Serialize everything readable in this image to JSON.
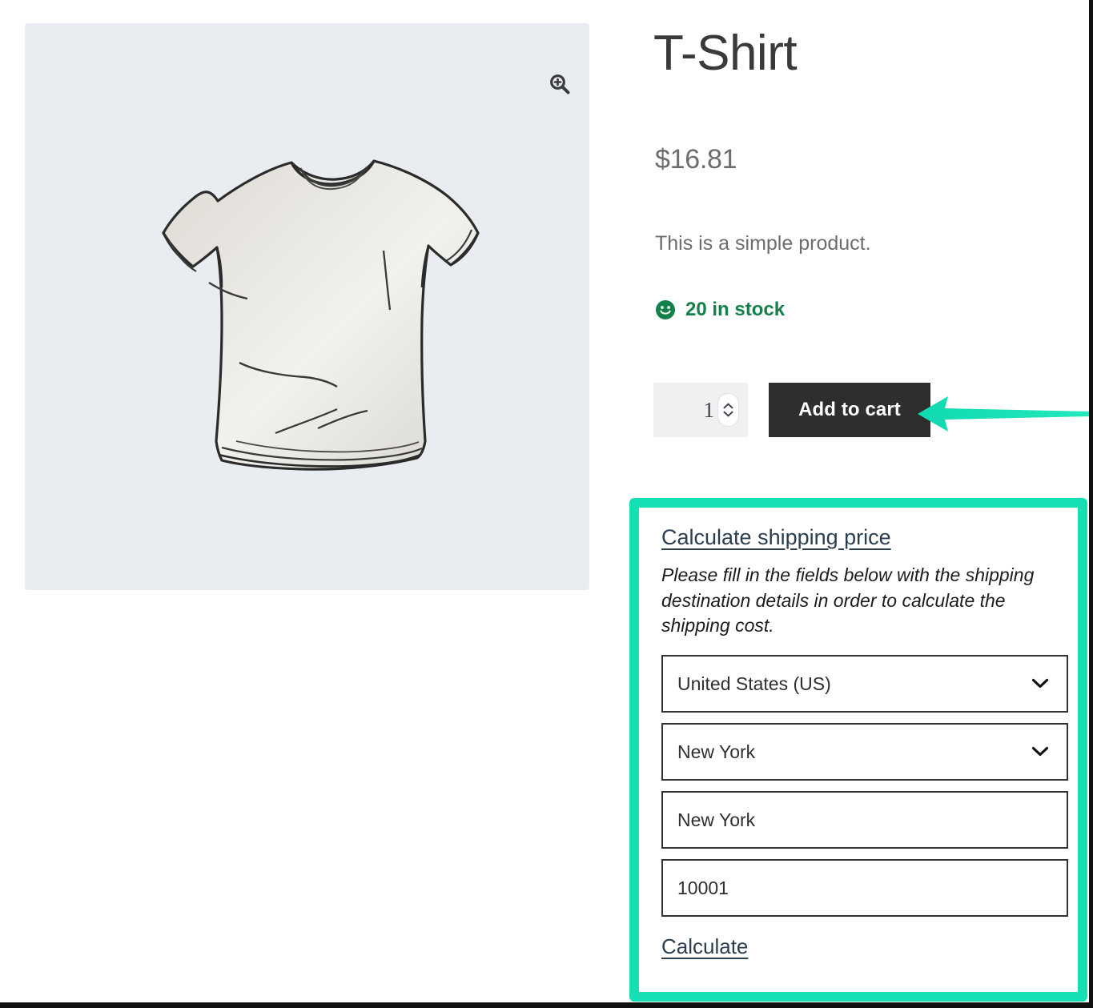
{
  "product": {
    "title": "T-Shirt",
    "price": "$16.81",
    "description": "This is a simple product.",
    "stock_status": "20 in stock",
    "stock_icon": "smiley-face-icon",
    "image_alt": "t-shirt-sketch-illustration",
    "zoom_icon": "magnifier-plus-icon"
  },
  "cart": {
    "quantity": "1",
    "add_to_cart_label": "Add to cart",
    "spinner_up_icon": "chevron-up-icon",
    "spinner_down_icon": "chevron-down-icon"
  },
  "shipping": {
    "link_label": "Calculate shipping price",
    "hint": "Please fill in the fields below with the shipping destination details in order to calculate the shipping cost.",
    "country": "United States (US)",
    "state": "New York",
    "city": "New York",
    "postcode": "10001",
    "calculate_label": "Calculate",
    "chevron_icon": "chevron-down-icon"
  },
  "colors": {
    "accent_teal": "#16dfb4",
    "arrow_teal": "#17e0b3",
    "link_navy": "#2b3e50",
    "stock_green": "#14804a",
    "button_dark": "#2e2e2e",
    "gallery_bg": "#e9edf1"
  }
}
